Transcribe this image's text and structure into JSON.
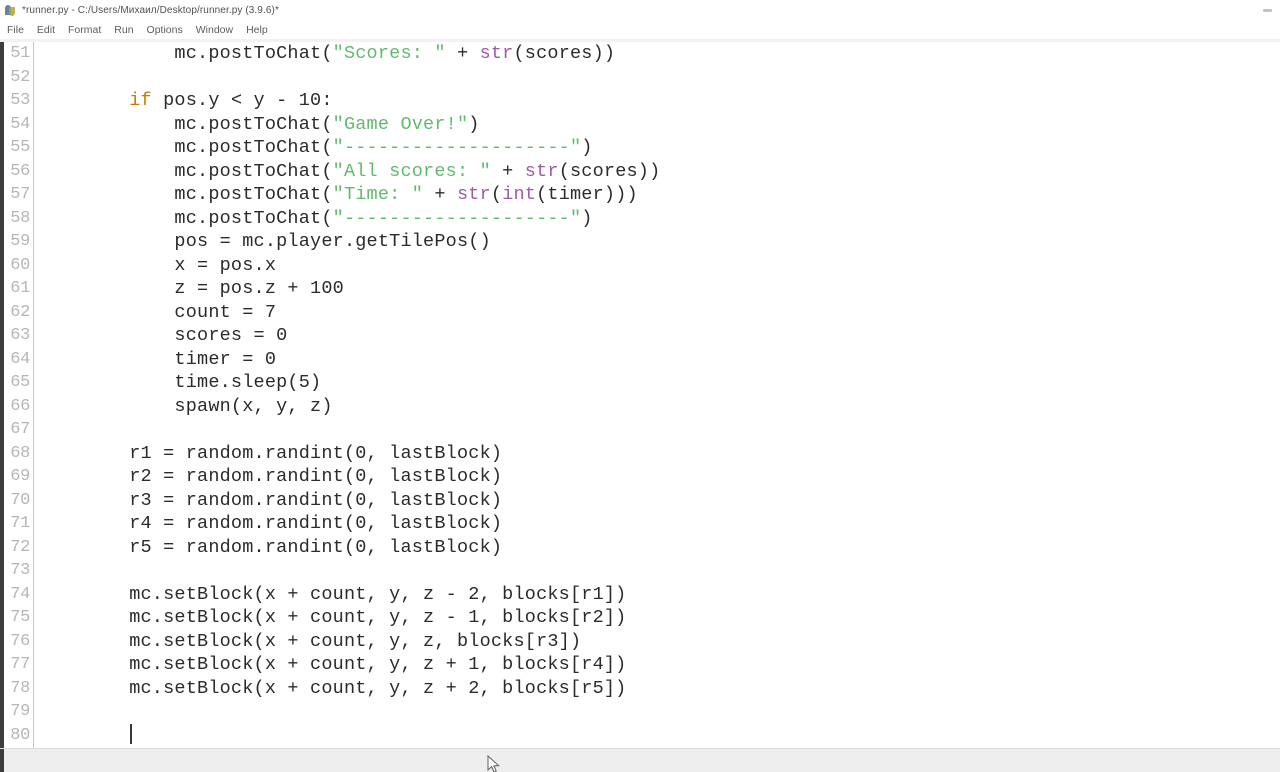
{
  "window": {
    "title": "*runner.py - C:/Users/Михаил/Desktop/runner.py (3.9.6)*",
    "app_icon": "python-idle-icon",
    "minimize_label": "—"
  },
  "menubar": {
    "items": [
      {
        "label": "File"
      },
      {
        "label": "Edit"
      },
      {
        "label": "Format"
      },
      {
        "label": "Run"
      },
      {
        "label": "Options"
      },
      {
        "label": "Window"
      },
      {
        "label": "Help"
      }
    ]
  },
  "editor": {
    "first_line_number": 51,
    "cursor_line": 80,
    "colors": {
      "keyword": "#cc7a00",
      "string": "#63ba6e",
      "builtin": "#a05aa8",
      "definition": "#1b51b5",
      "text": "#2b2b2b",
      "gutter_text": "#b6b6b6",
      "background": "#ffffff"
    },
    "lines": [
      {
        "n": "51",
        "tokens": [
          {
            "t": "        mc.postToChat(",
            "c": ""
          },
          {
            "t": "\"Scores: \"",
            "c": "tok-str"
          },
          {
            "t": " + ",
            "c": ""
          },
          {
            "t": "str",
            "c": "tok-bi"
          },
          {
            "t": "(scores))",
            "c": ""
          }
        ]
      },
      {
        "n": "52",
        "tokens": [
          {
            "t": "",
            "c": ""
          }
        ]
      },
      {
        "n": "53",
        "tokens": [
          {
            "t": "    ",
            "c": ""
          },
          {
            "t": "if",
            "c": "tok-kw"
          },
          {
            "t": " pos.y < y - 10:",
            "c": ""
          }
        ]
      },
      {
        "n": "54",
        "tokens": [
          {
            "t": "        mc.postToChat(",
            "c": ""
          },
          {
            "t": "\"Game Over!\"",
            "c": "tok-str"
          },
          {
            "t": ")",
            "c": ""
          }
        ]
      },
      {
        "n": "55",
        "tokens": [
          {
            "t": "        mc.postToChat(",
            "c": ""
          },
          {
            "t": "\"--------------------\"",
            "c": "tok-str"
          },
          {
            "t": ")",
            "c": ""
          }
        ]
      },
      {
        "n": "56",
        "tokens": [
          {
            "t": "        mc.postToChat(",
            "c": ""
          },
          {
            "t": "\"All scores: \"",
            "c": "tok-str"
          },
          {
            "t": " + ",
            "c": ""
          },
          {
            "t": "str",
            "c": "tok-bi"
          },
          {
            "t": "(scores))",
            "c": ""
          }
        ]
      },
      {
        "n": "57",
        "tokens": [
          {
            "t": "        mc.postToChat(",
            "c": ""
          },
          {
            "t": "\"Time: \"",
            "c": "tok-str"
          },
          {
            "t": " + ",
            "c": ""
          },
          {
            "t": "str",
            "c": "tok-bi"
          },
          {
            "t": "(",
            "c": ""
          },
          {
            "t": "int",
            "c": "tok-bi"
          },
          {
            "t": "(timer)))",
            "c": ""
          }
        ]
      },
      {
        "n": "58",
        "tokens": [
          {
            "t": "        mc.postToChat(",
            "c": ""
          },
          {
            "t": "\"--------------------\"",
            "c": "tok-str"
          },
          {
            "t": ")",
            "c": ""
          }
        ]
      },
      {
        "n": "59",
        "tokens": [
          {
            "t": "        pos = mc.player.getTilePos()",
            "c": ""
          }
        ]
      },
      {
        "n": "60",
        "tokens": [
          {
            "t": "        x = pos.x",
            "c": ""
          }
        ]
      },
      {
        "n": "61",
        "tokens": [
          {
            "t": "        z = pos.z + 100",
            "c": ""
          }
        ]
      },
      {
        "n": "62",
        "tokens": [
          {
            "t": "        count = 7",
            "c": ""
          }
        ]
      },
      {
        "n": "63",
        "tokens": [
          {
            "t": "        scores = 0",
            "c": ""
          }
        ]
      },
      {
        "n": "64",
        "tokens": [
          {
            "t": "        timer = 0",
            "c": ""
          }
        ]
      },
      {
        "n": "65",
        "tokens": [
          {
            "t": "        time.sleep(5)",
            "c": ""
          }
        ]
      },
      {
        "n": "66",
        "tokens": [
          {
            "t": "        spawn(x, y, z)",
            "c": ""
          }
        ]
      },
      {
        "n": "67",
        "tokens": [
          {
            "t": "",
            "c": ""
          }
        ]
      },
      {
        "n": "68",
        "tokens": [
          {
            "t": "    r1 = random.randint(0, lastBlock)",
            "c": ""
          }
        ]
      },
      {
        "n": "69",
        "tokens": [
          {
            "t": "    r2 = random.randint(0, lastBlock)",
            "c": ""
          }
        ]
      },
      {
        "n": "70",
        "tokens": [
          {
            "t": "    r3 = random.randint(0, lastBlock)",
            "c": ""
          }
        ]
      },
      {
        "n": "71",
        "tokens": [
          {
            "t": "    r4 = random.randint(0, lastBlock)",
            "c": ""
          }
        ]
      },
      {
        "n": "72",
        "tokens": [
          {
            "t": "    r5 = random.randint(0, lastBlock)",
            "c": ""
          }
        ]
      },
      {
        "n": "73",
        "tokens": [
          {
            "t": "",
            "c": ""
          }
        ]
      },
      {
        "n": "74",
        "tokens": [
          {
            "t": "    mc.setBlock(x + count, y, z - 2, blocks[r1])",
            "c": ""
          }
        ]
      },
      {
        "n": "75",
        "tokens": [
          {
            "t": "    mc.setBlock(x + count, y, z - 1, blocks[r2])",
            "c": ""
          }
        ]
      },
      {
        "n": "76",
        "tokens": [
          {
            "t": "    mc.setBlock(x + count, y, z, blocks[r3])",
            "c": ""
          }
        ]
      },
      {
        "n": "77",
        "tokens": [
          {
            "t": "    mc.setBlock(x + count, y, z + 1, blocks[r4])",
            "c": ""
          }
        ]
      },
      {
        "n": "78",
        "tokens": [
          {
            "t": "    mc.setBlock(x + count, y, z + 2, blocks[r5])",
            "c": ""
          }
        ]
      },
      {
        "n": "79",
        "tokens": [
          {
            "t": "",
            "c": ""
          }
        ]
      },
      {
        "n": "80",
        "tokens": [
          {
            "t": "    ",
            "c": ""
          }
        ],
        "caret": true
      }
    ]
  }
}
